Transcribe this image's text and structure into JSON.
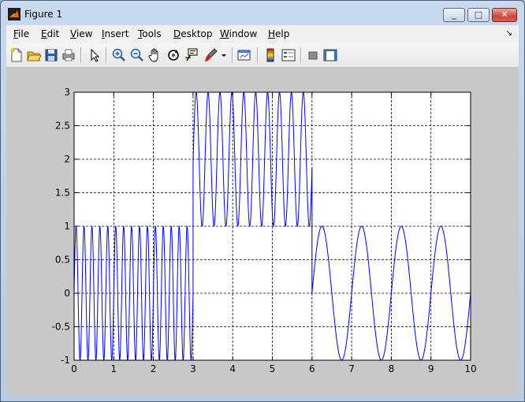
{
  "window": {
    "title": "Figure 1"
  },
  "menu": [
    "File",
    "Edit",
    "View",
    "Insert",
    "Tools",
    "Desktop",
    "Window",
    "Help"
  ],
  "toolbar": [
    "new-figure",
    "open-file",
    "save-figure",
    "print-figure",
    "edit-plot",
    "zoom-in",
    "zoom-out",
    "pan",
    "rotate-3d",
    "data-cursor",
    "brush",
    "link-plot",
    "insert-colorbar",
    "insert-legend",
    "hide-plot-tools",
    "show-plot-tools"
  ],
  "chart_data": {
    "type": "line",
    "title": "",
    "xlabel": "",
    "ylabel": "",
    "xlim": [
      0,
      10
    ],
    "ylim": [
      -1,
      3
    ],
    "grid": true,
    "x_ticks": [
      "0",
      "1",
      "2",
      "3",
      "4",
      "5",
      "6",
      "7",
      "8",
      "9",
      "10"
    ],
    "y_ticks": [
      "-1",
      "-0.5",
      "0",
      "0.5",
      "1",
      "1.5",
      "2",
      "2.5",
      "3"
    ],
    "series": [
      {
        "color": "#0000ff",
        "segments": [
          {
            "x_range": [
              0,
              3
            ],
            "function": "sin",
            "frequency_hz": 5,
            "amplitude": 1,
            "offset": 0
          },
          {
            "x_range": [
              3,
              6
            ],
            "function": "sin",
            "frequency_hz": 3.33,
            "amplitude": 1,
            "offset": 2
          },
          {
            "x_range": [
              6,
              10
            ],
            "function": "sin",
            "frequency_hz": 1,
            "amplitude": 1,
            "offset": 0
          }
        ]
      }
    ]
  }
}
